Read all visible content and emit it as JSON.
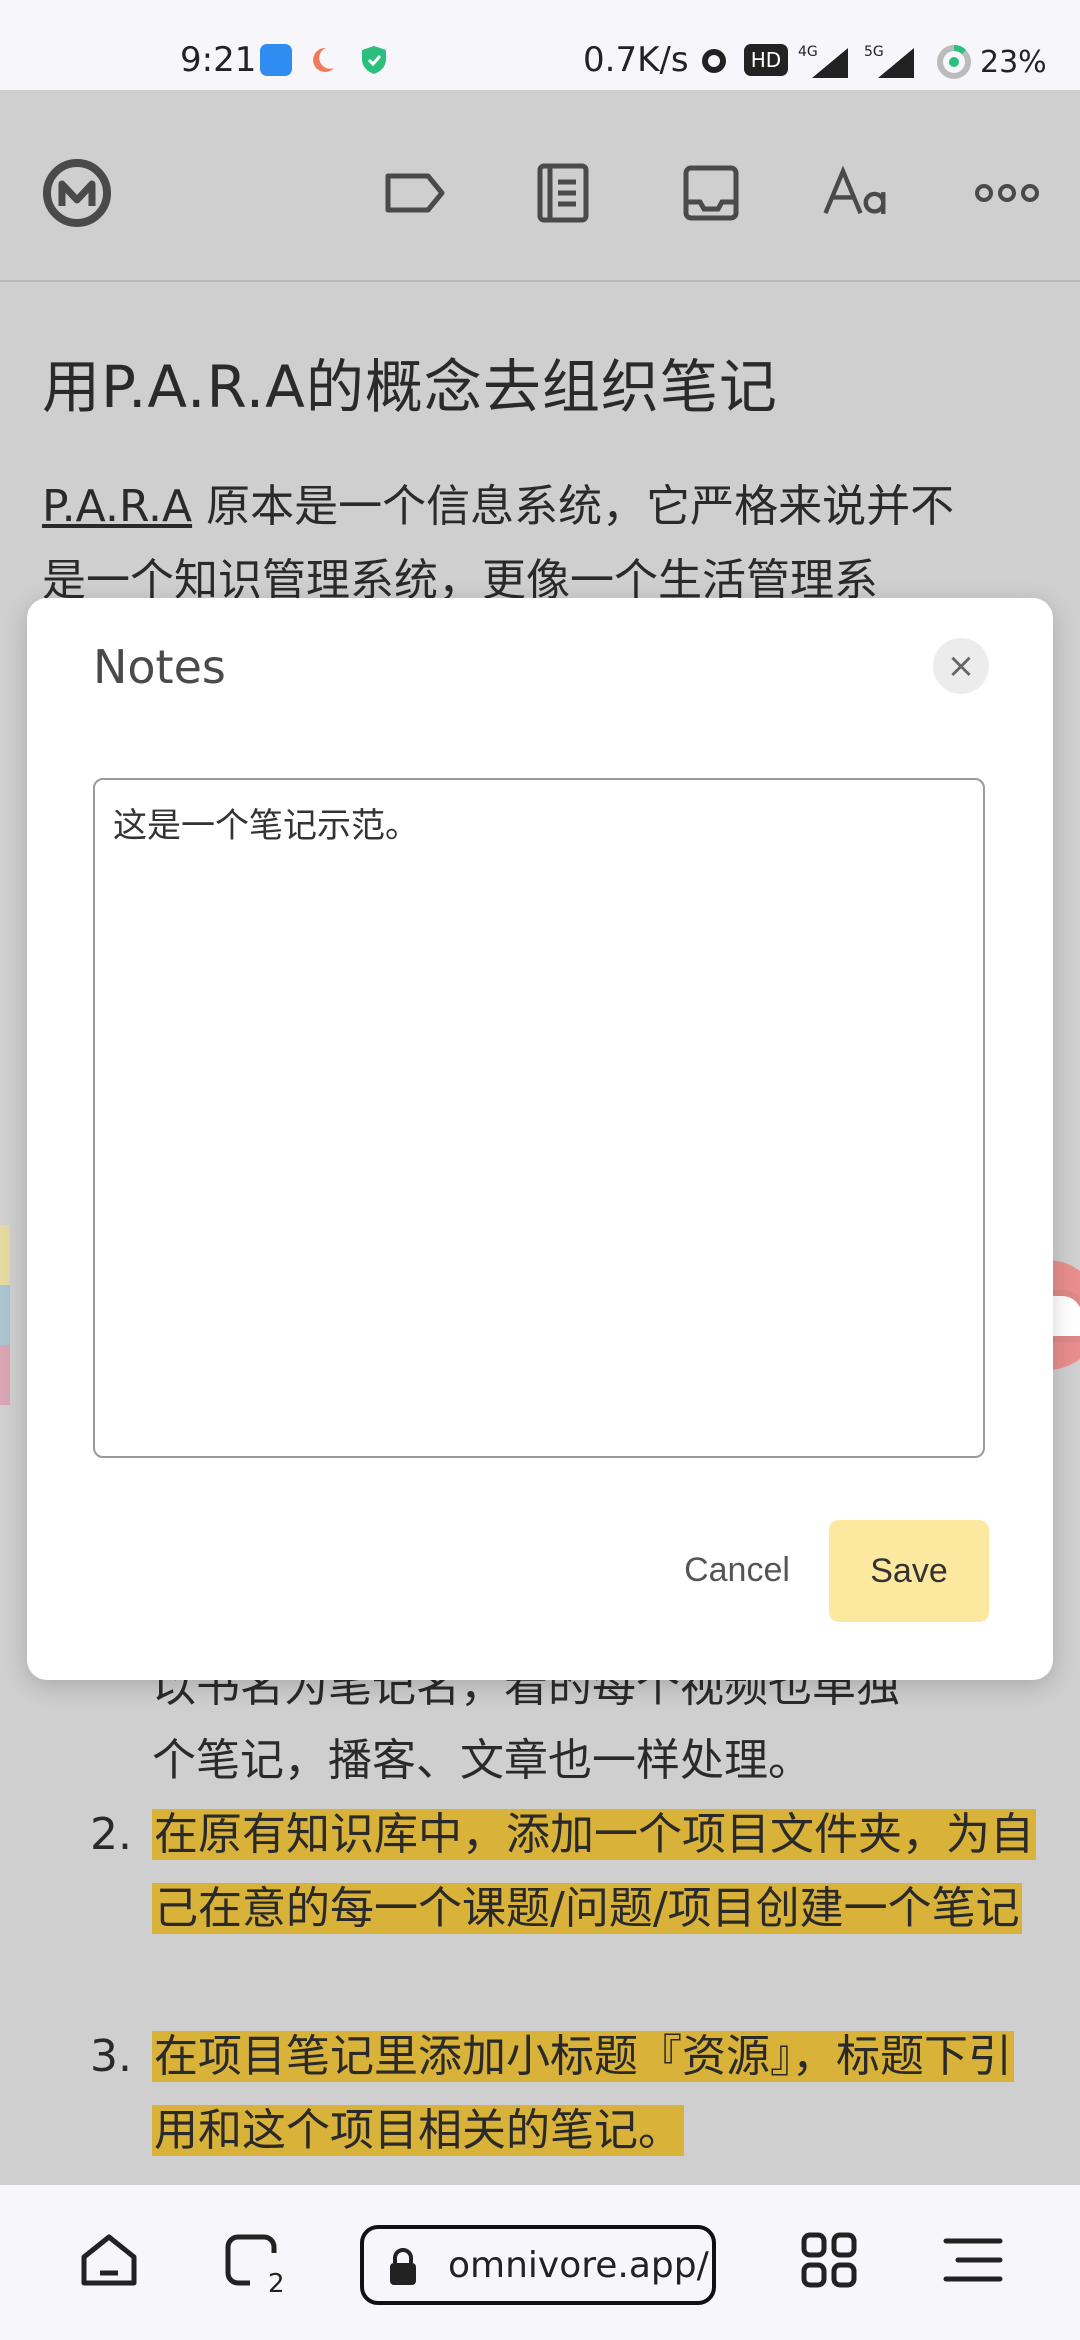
{
  "status_bar": {
    "time": "9:21",
    "net_speed": "0.7K/s",
    "battery": "23%",
    "icons": [
      "app-icon-blue",
      "moon-icon",
      "shield-icon",
      "alarm-icon",
      "hd-icon",
      "signal-4g-icon",
      "signal-5g-icon",
      "battery-ring-icon"
    ]
  },
  "toolbar": {
    "icons": [
      "omnivore-logo-icon",
      "label-icon",
      "notebook-icon",
      "inbox-icon",
      "font-icon",
      "more-icon"
    ]
  },
  "article": {
    "title": "用P.A.R.A的概念去组织笔记",
    "para_link": "P.A.R.A",
    "para_line1_rest": " 原本是一个信息系统，它严格来说并不",
    "para_line2": "是一个知识管理系统，更像一个生活管理系",
    "list_partial_line1": "以书名为笔记名，看的每个视频也单独",
    "list_partial_line2": "个笔记，播客、文章也一样处理。",
    "list_items": [
      {
        "num": "2.",
        "text": "在原有知识库中，添加一个项目文件夹，为自己在意的每一个课题/问题/项目创建一个笔记"
      },
      {
        "num": "3.",
        "text": "在项目笔记里添加小标题『资源』，标题下引用和这个项目相关的笔记。"
      }
    ],
    "highlight_color": "#d9b23a"
  },
  "modal": {
    "title": "Notes",
    "close_label": "×",
    "note_value": "这是一个笔记示范。",
    "cancel_label": "Cancel",
    "save_label": "Save",
    "save_color": "#fce89e"
  },
  "browser_bar": {
    "tab_count": "2",
    "url": "omnivore.app/",
    "icons": [
      "home-icon",
      "tabs-icon",
      "lock-icon",
      "grid-icon",
      "menu-icon"
    ]
  }
}
